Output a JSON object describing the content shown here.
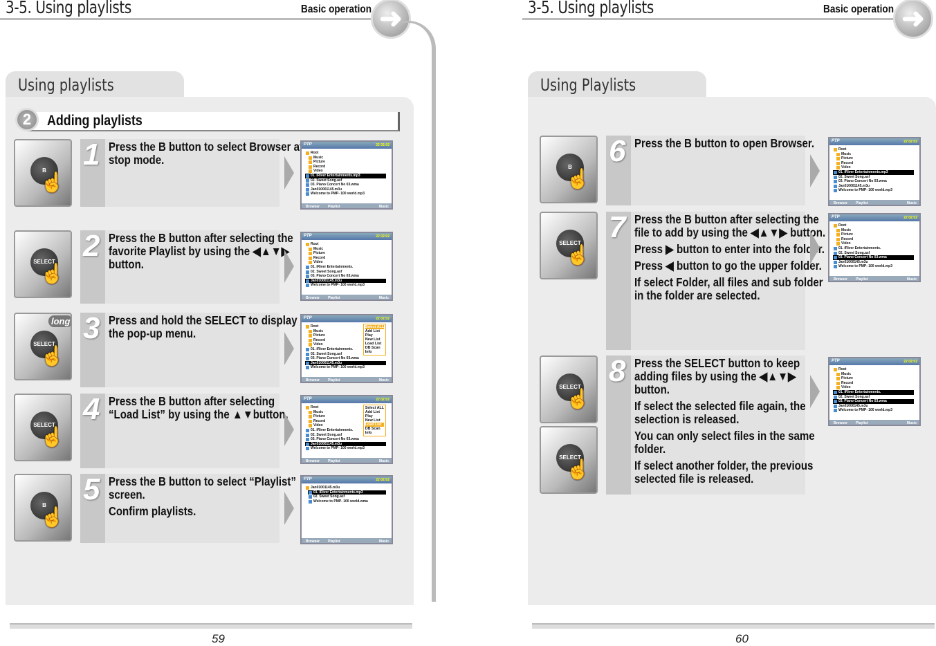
{
  "left": {
    "chapter": "3-5. Using playlists",
    "section": "Basic operation",
    "tab": "Using playlists",
    "subheading_num": "2",
    "subheading": "Adding playlists",
    "page_number": "59",
    "steps": [
      {
        "num": "1",
        "device": "B",
        "lines": [
          "Press the B button to select Browser at stop mode."
        ]
      },
      {
        "num": "2",
        "device": "SELECT",
        "lines": [
          "Press the B button after selecting the favorite Playlist by using the ◀▲▼▶ button."
        ]
      },
      {
        "num": "3",
        "device": "SELECT",
        "badge": "long",
        "lines": [
          "Press and hold the SELECT to display the pop-up menu."
        ]
      },
      {
        "num": "4",
        "device": "SELECT",
        "lines": [
          "Press the B button after selecting “Load List” by using the ▲▼button."
        ]
      },
      {
        "num": "5",
        "device": "B",
        "lines": [
          "Press the B button to select “Playlist” screen.",
          "Confirm playlists."
        ]
      }
    ]
  },
  "right": {
    "chapter": "3-5. Using playlists",
    "section": "Basic operation",
    "tab": "Using Playlists",
    "page_number": "60",
    "steps": [
      {
        "num": "6",
        "device": "B",
        "lines": [
          "Press the B button to open Browser."
        ]
      },
      {
        "num": "7",
        "device": "SELECT",
        "lines": [
          "Press the B button after selecting the file to add by using the ◀▲▼▶ button.",
          "Press ▶ button to enter into the folder.",
          "Press ◀ button to go the upper folder.",
          "If select Folder, all files and sub folder in the folder are selected."
        ]
      },
      {
        "num": "8",
        "device": "SELECT",
        "lines": [
          "Press the SELECT button to keep adding files by using the ◀▲▼▶ button.",
          "If select the selected file again, the selection is released.",
          "You can only select files in the same folder.",
          "If select another folder, the previous selected file is released."
        ]
      }
    ]
  },
  "screens": [
    {
      "title": "PTP",
      "status": "22 02:02",
      "tabs": [
        "Browser",
        "Playlist",
        "Music"
      ],
      "rows": [
        {
          "t": "Root",
          "f": 1
        },
        {
          "t": "Music",
          "f": 1,
          "s": 1
        },
        {
          "t": "Picture",
          "f": 1,
          "s": 1
        },
        {
          "t": "Record",
          "f": 1,
          "s": 1
        },
        {
          "t": "Video",
          "f": 1,
          "s": 1
        },
        {
          "t": "01. iRiver Entertainments.mp3",
          "hl": 1
        },
        {
          "t": "02. Sweet Song.asf"
        },
        {
          "t": "03. Piano Concert No 03.wma"
        },
        {
          "t": "Jan010001145.m3u"
        },
        {
          "t": "Welcome to PMP- 100 world.mp3"
        }
      ]
    },
    {
      "title": "PTP",
      "status": "22 02:02",
      "tabs": [
        "Browser",
        "Playlist",
        "Music"
      ],
      "rows": [
        {
          "t": "Root",
          "f": 1
        },
        {
          "t": "Music",
          "f": 1,
          "s": 1
        },
        {
          "t": "Picture",
          "f": 1,
          "s": 1
        },
        {
          "t": "Record",
          "f": 1,
          "s": 1
        },
        {
          "t": "Video",
          "f": 1,
          "s": 1
        },
        {
          "t": "01. iRiver Entertainments."
        },
        {
          "t": "02. Sweet Song.asf"
        },
        {
          "t": "03. Piano Concert No 03.wma"
        },
        {
          "t": "Jan010001145.m3u",
          "hl": 1
        },
        {
          "t": "Welcome to PMP- 100 world.mp3"
        }
      ]
    },
    {
      "title": "PTP",
      "status": "22 02:02",
      "tabs": [
        "Browser",
        "Playlist",
        "Music"
      ],
      "popup": [
        "Select ALL",
        "Add List",
        "Play",
        "New List",
        "Load List",
        "DB Scan",
        "Info"
      ],
      "popup_hl": 0,
      "rows": [
        {
          "t": "Root",
          "f": 1
        },
        {
          "t": "Music",
          "f": 1,
          "s": 1
        },
        {
          "t": "Picture",
          "f": 1,
          "s": 1
        },
        {
          "t": "Record",
          "f": 1,
          "s": 1
        },
        {
          "t": "Video",
          "f": 1,
          "s": 1
        },
        {
          "t": "01. iRiver Entertainments."
        },
        {
          "t": "02. Sweet Song.asf"
        },
        {
          "t": "03. Piano Concert No 03.wma"
        },
        {
          "t": "Jan010001145.m3u",
          "hl": 1
        },
        {
          "t": "Welcome to PMP- 100 world.mp3"
        }
      ]
    },
    {
      "title": "PTP",
      "status": "22 02:02",
      "tabs": [
        "Browser",
        "Playlist",
        "Music"
      ],
      "popup": [
        "Select ALL",
        "Add List",
        "Play",
        "New List",
        "Load List",
        "DB Scan",
        "Info"
      ],
      "popup_hl": 4,
      "rows": [
        {
          "t": "Root",
          "f": 1
        },
        {
          "t": "Music",
          "f": 1,
          "s": 1
        },
        {
          "t": "Picture",
          "f": 1,
          "s": 1
        },
        {
          "t": "Record",
          "f": 1,
          "s": 1
        },
        {
          "t": "Video",
          "f": 1,
          "s": 1
        },
        {
          "t": "01. iRiver Entertainments."
        },
        {
          "t": "02. Sweet Song.asf"
        },
        {
          "t": "03. Piano Concert No 03.wma"
        },
        {
          "t": "Jan010001145.m3u",
          "hl": 1
        },
        {
          "t": "Welcome to PMP- 100 world.mp3"
        }
      ]
    },
    {
      "title": "PTP",
      "status": "22 02:02",
      "tabs": [
        "Browser",
        "Playlist",
        "Music"
      ],
      "rows": [
        {
          "t": "Jan01001145.m3u",
          "f": 1
        },
        {
          "t": "01. iRiver Entertainments.mp3",
          "s": 1,
          "hl": 1
        },
        {
          "t": "02. Sweet Song.asf",
          "s": 1
        },
        {
          "t": "Welcome to PMP- 100 world.wma",
          "s": 1
        }
      ]
    },
    {
      "title": "PTP",
      "status": "22 02:02",
      "tabs": [
        "Browser",
        "Playlist",
        "Music"
      ],
      "rows": [
        {
          "t": "Root",
          "f": 1
        },
        {
          "t": "Music",
          "f": 1,
          "s": 1
        },
        {
          "t": "Picture",
          "f": 1,
          "s": 1
        },
        {
          "t": "Record",
          "f": 1,
          "s": 1
        },
        {
          "t": "Video",
          "f": 1,
          "s": 1
        },
        {
          "t": "01. iRiver Entertainments.mp3",
          "hl": 1
        },
        {
          "t": "02. Sweet Song.asf"
        },
        {
          "t": "03. Piano Concert No 03.wma"
        },
        {
          "t": "Jan010001145.m3u"
        },
        {
          "t": "Welcome to PMP- 100 world.mp3"
        }
      ]
    },
    {
      "title": "PTP",
      "status": "22 02:02",
      "tabs": [
        "Browser",
        "Playlist",
        "Music"
      ],
      "rows": [
        {
          "t": "Root",
          "f": 1
        },
        {
          "t": "Music",
          "f": 1,
          "s": 1
        },
        {
          "t": "Picture",
          "f": 1,
          "s": 1
        },
        {
          "t": "Record",
          "f": 1,
          "s": 1
        },
        {
          "t": "Video",
          "f": 1,
          "s": 1
        },
        {
          "t": "01. iRiver Entertainments."
        },
        {
          "t": "02. Sweet Song.asf"
        },
        {
          "t": "03. Piano Concert No 03.wma",
          "hl": 1
        },
        {
          "t": "Jan01000145.m3u"
        },
        {
          "t": "Welcome to PMP- 100 world.mp3"
        }
      ]
    },
    {
      "title": "PTP",
      "status": "22 02:02",
      "tabs": [
        "Browser",
        "Playlist",
        "Music"
      ],
      "rows": [
        {
          "t": "Root",
          "f": 1
        },
        {
          "t": "Music",
          "f": 1,
          "s": 1
        },
        {
          "t": "Picture",
          "f": 1,
          "s": 1
        },
        {
          "t": "Record",
          "f": 1,
          "s": 1
        },
        {
          "t": "Video",
          "f": 1,
          "s": 1
        },
        {
          "t": "01. iRiver Entertainments.",
          "hl": 1
        },
        {
          "t": "02. Sweet Song.asf"
        },
        {
          "t": "03. Piano Concert No 03.wma",
          "hl": 1
        },
        {
          "t": "Jan01000145.m3u"
        },
        {
          "t": "Welcome to PMP- 100 world.mp3"
        }
      ]
    }
  ]
}
